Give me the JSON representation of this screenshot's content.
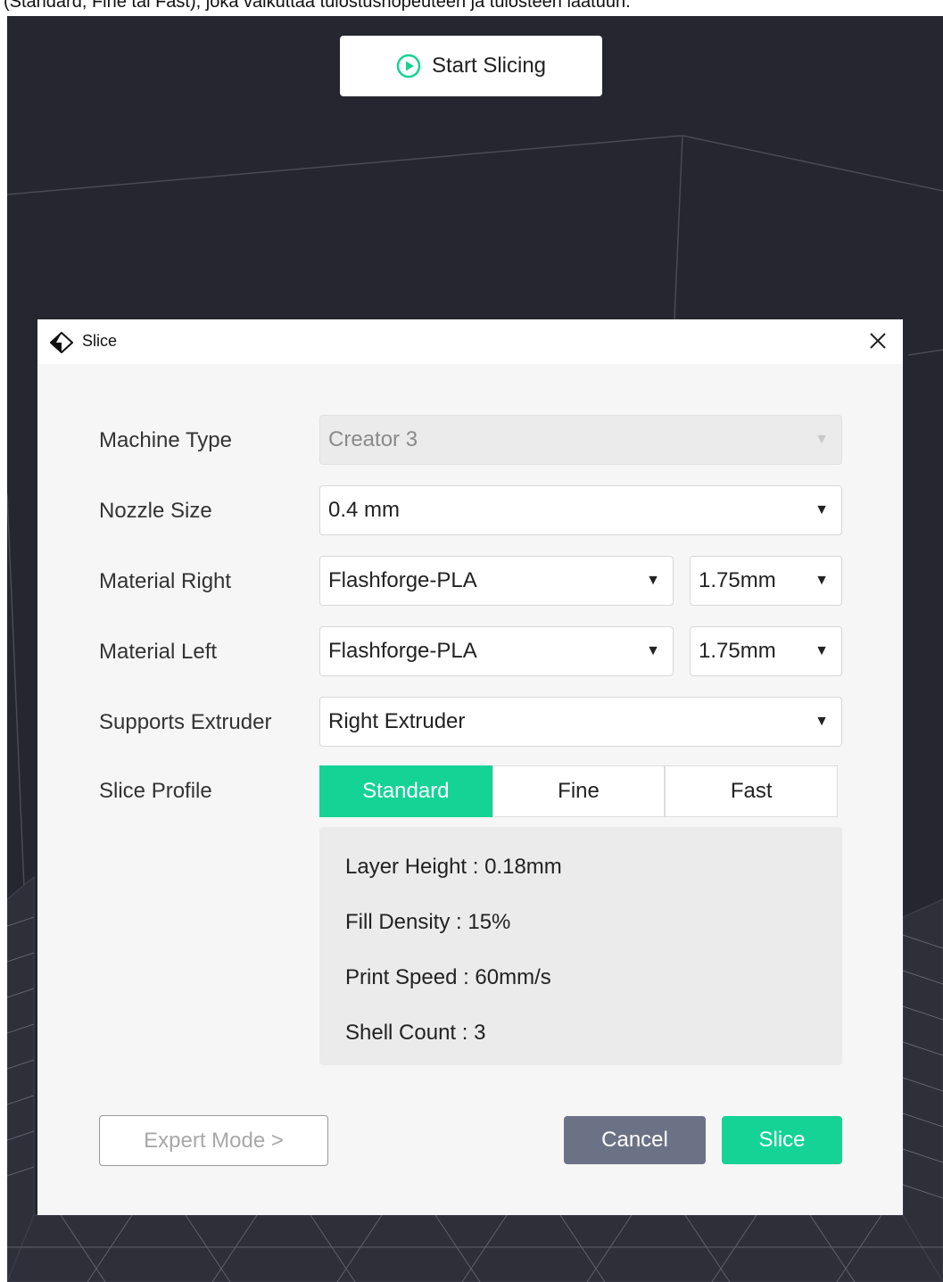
{
  "caption": "(Standard, Fine tai Fast), joka vaikuttaa tulostusnopeuteen ja tulosteen laatuun.",
  "toolbar": {
    "start_label": "Start Slicing",
    "start_icon": "play-circle-icon"
  },
  "dialog": {
    "title": "Slice",
    "title_icon": "flashforge-logo-icon",
    "close_icon": "close-icon",
    "machine_type": {
      "label": "Machine Type",
      "value": "Creator 3"
    },
    "nozzle_size": {
      "label": "Nozzle Size",
      "value": "0.4 mm"
    },
    "material_right": {
      "label": "Material Right",
      "value": "Flashforge-PLA",
      "diameter": "1.75mm"
    },
    "material_left": {
      "label": "Material Left",
      "value": "Flashforge-PLA",
      "diameter": "1.75mm"
    },
    "supports_extruder": {
      "label": "Supports Extruder",
      "value": "Right Extruder"
    },
    "slice_profile": {
      "label": "Slice Profile",
      "options": [
        "Standard",
        "Fine",
        "Fast"
      ],
      "selected": "Standard"
    },
    "profile_details": {
      "layer_height": "Layer Height : 0.18mm",
      "fill_density": "Fill Density : 15%",
      "print_speed": "Print Speed : 60mm/s",
      "shell_count": "Shell Count : 3"
    },
    "buttons": {
      "expert": "Expert Mode >",
      "cancel": "Cancel",
      "slice": "Slice"
    }
  },
  "colors": {
    "accent": "#14d394",
    "cancel": "#6b7285",
    "background": "#262630"
  }
}
